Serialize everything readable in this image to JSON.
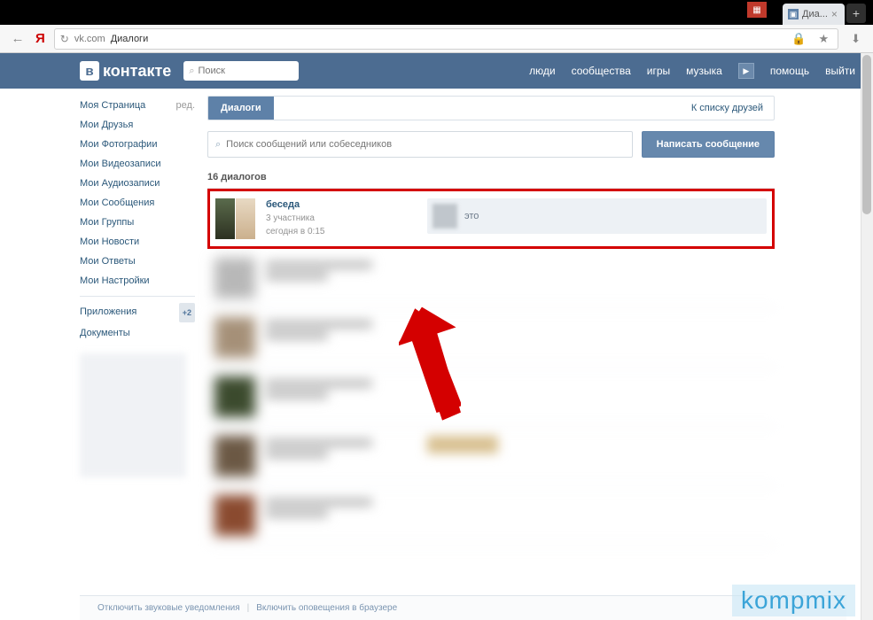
{
  "browser": {
    "tab_title": "Диа...",
    "new_tab": "+",
    "close": "×",
    "nav_back": "←",
    "yandex": "Я",
    "reload": "↻",
    "domain": "vk.com",
    "page_title": "Диалоги",
    "lock": "🔒",
    "star": "★",
    "download": "⬇"
  },
  "vk_header": {
    "logo_letter": "в",
    "logo_text": "контакте",
    "search_placeholder": "Поиск",
    "nav": {
      "people": "люди",
      "communities": "сообщества",
      "games": "игры",
      "music": "музыка",
      "play": "▶",
      "help": "помощь",
      "logout": "выйти"
    }
  },
  "sidebar": {
    "edit": "ред.",
    "items": [
      "Моя Страница",
      "Мои Друзья",
      "Мои Фотографии",
      "Мои Видеозаписи",
      "Мои Аудиозаписи",
      "Мои Сообщения",
      "Мои Группы",
      "Мои Новости",
      "Мои Ответы",
      "Мои Настройки"
    ],
    "apps": "Приложения",
    "apps_badge": "+2",
    "docs": "Документы"
  },
  "main": {
    "tab_active": "Диалоги",
    "friends_link": "К списку друзей",
    "search_placeholder": "Поиск сообщений или собеседников",
    "compose": "Написать сообщение",
    "count": "16 диалогов",
    "dialog1": {
      "title": "беседа",
      "members": "3 участника",
      "time": "сегодня в 0:15",
      "preview": "это"
    }
  },
  "footer": {
    "sound": "Отключить звуковые уведомления",
    "sep": "|",
    "browser_notif": "Включить оповещения в браузере"
  },
  "watermark": "kompmix"
}
